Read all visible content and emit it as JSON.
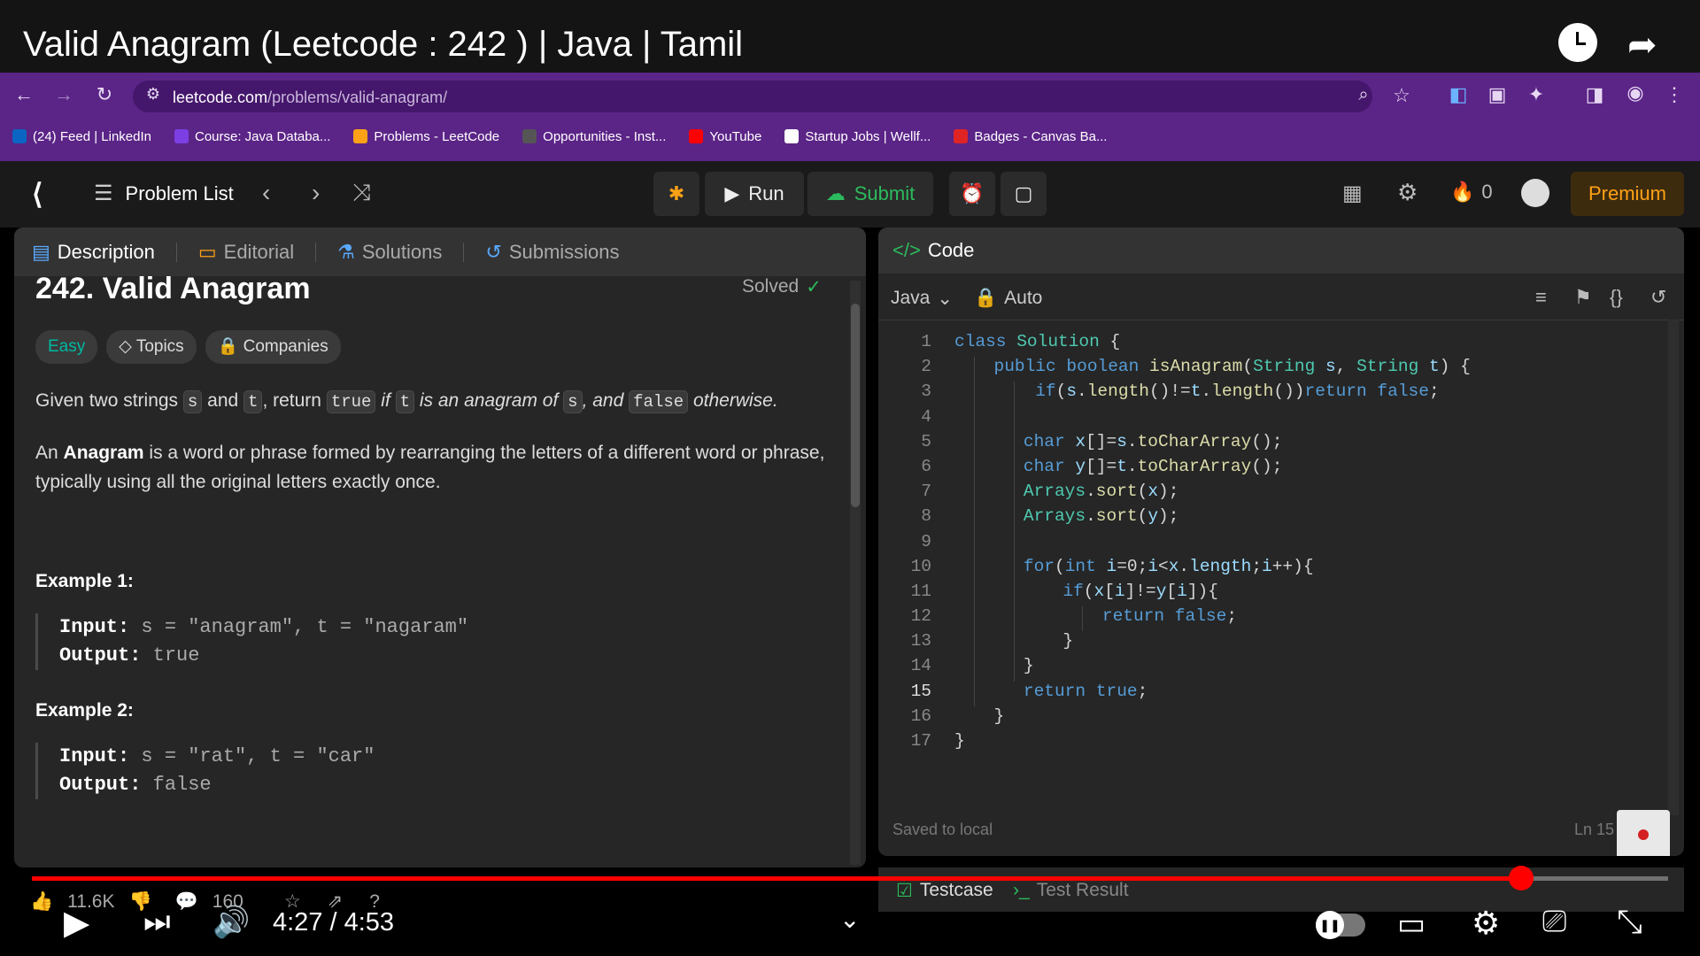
{
  "video": {
    "title": "Valid Anagram (Leetcode : 242 ) | Java | Tamil",
    "time": "4:27 / 4:53",
    "progress_fraction": 0.91
  },
  "browser": {
    "url_domain": "leetcode.com",
    "url_path": "/problems/valid-anagram/",
    "bookmarks": [
      {
        "label": "(24) Feed | LinkedIn",
        "color": "#0a66c2"
      },
      {
        "label": "Course: Java Databa...",
        "color": "#7b3fe4"
      },
      {
        "label": "Problems - LeetCode",
        "color": "#ffa116"
      },
      {
        "label": "Opportunities - Inst...",
        "color": "#555555"
      },
      {
        "label": "YouTube",
        "color": "#ff0000"
      },
      {
        "label": "Startup Jobs | Wellf...",
        "color": "#ffffff"
      },
      {
        "label": "Badges - Canvas Ba...",
        "color": "#e02424"
      }
    ]
  },
  "lc_top": {
    "problem_list": "Problem List",
    "run": "Run",
    "submit": "Submit",
    "streak": "0",
    "premium": "Premium"
  },
  "description": {
    "tabs": [
      "Description",
      "Editorial",
      "Solutions",
      "Submissions"
    ],
    "title": "242. Valid Anagram",
    "solved": "Solved",
    "tags": [
      "Easy",
      "Topics",
      "Companies"
    ],
    "p1": {
      "a": "Given two strings",
      "s": "s",
      "and": "and",
      "t": "t",
      "comma_return": ", return",
      "true": "true",
      "if": "if",
      "t2": "t",
      "mid": "is an anagram of",
      "s2": "s",
      "comma_and": ", and",
      "false": "false",
      "end": "otherwise."
    },
    "p2": {
      "a": "An",
      "bold": "Anagram",
      "rest": "is a word or phrase formed by rearranging the letters of a different word or phrase, typically using all the original letters exactly once."
    },
    "examples": [
      {
        "title": "Example 1:",
        "input_label": "Input:",
        "input": "s = \"anagram\", t = \"nagaram\"",
        "output_label": "Output:",
        "output": "true"
      },
      {
        "title": "Example 2:",
        "input_label": "Input:",
        "input": "s = \"rat\", t = \"car\"",
        "output_label": "Output:",
        "output": "false"
      }
    ]
  },
  "code": {
    "header": "Code",
    "language": "Java",
    "mode": "Auto",
    "saved": "Saved to local",
    "cursor": "Ln 15"
  },
  "bottom": {
    "testcase": "Testcase",
    "test_result": "Test Result"
  },
  "yt_stats": {
    "likes": "11.6K",
    "comments": "160"
  }
}
